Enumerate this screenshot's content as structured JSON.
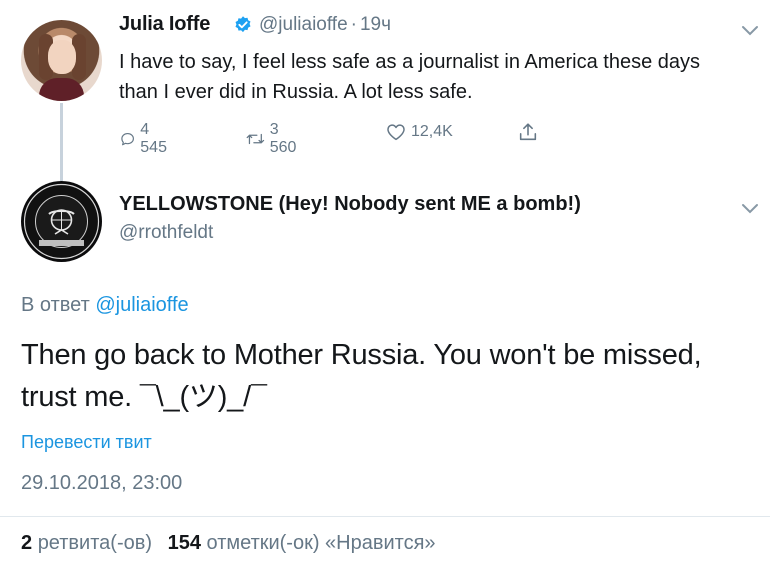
{
  "parent_tweet": {
    "display_name": "Julia Ioffe",
    "handle": "@juliaioffe",
    "separator": "·",
    "time_ago": "19ч",
    "text": "I have to say, I feel less safe as a journalist in America these days than I ever did in Russia. A lot less safe.",
    "actions": {
      "reply_count": "4 545",
      "retweet_count": "3 560",
      "like_count": "12,4K"
    }
  },
  "reply_tweet": {
    "display_name": "YELLOWSTONE (Hey! Nobody sent ME a bomb!)",
    "handle": "@rrothfeldt",
    "avatar_text": "UNITED STATES MARINE CORPS · VETERAN",
    "replying_prefix": "В ответ",
    "replying_to": "@juliaioffe",
    "text": "Then go back to Mother Russia. You won't be missed, trust me.  ¯\\_(ツ)_/¯",
    "translate_label": "Перевести твит",
    "datetime": "29.10.2018, 23:00",
    "stats": {
      "retweets_count": "2",
      "retweets_label": "ретвита(-ов)",
      "likes_count": "154",
      "likes_label": "отметки(-ок) «Нравится»"
    }
  },
  "colors": {
    "accent": "#1b95e0",
    "secondary_text": "#657786",
    "primary_text": "#14171a",
    "thread_line": "#c7d2dc",
    "divider": "#e1e8ed"
  },
  "icons": [
    "verified-badge-icon",
    "chevron-down-icon",
    "reply-icon",
    "retweet-icon",
    "like-icon",
    "share-icon"
  ]
}
